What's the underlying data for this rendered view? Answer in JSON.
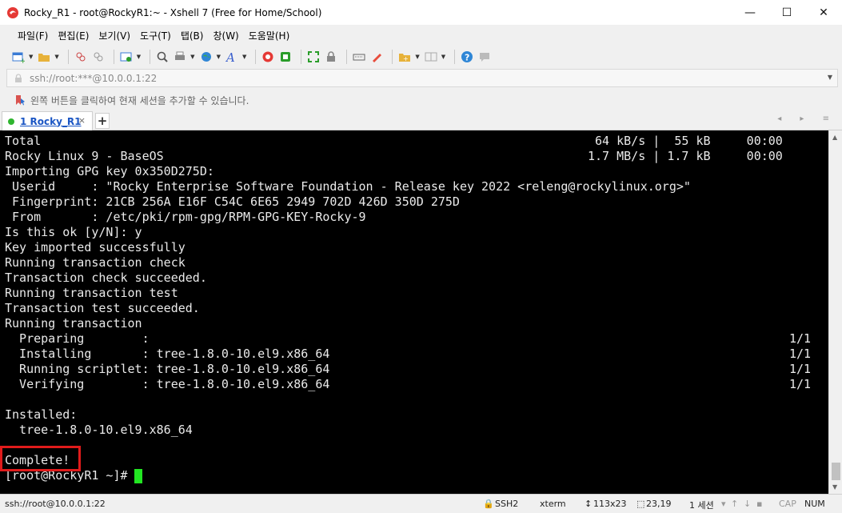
{
  "window": {
    "title": "Rocky_R1 - root@RockyR1:~ - Xshell 7 (Free for Home/School)",
    "minimize": "—",
    "maximize": "☐",
    "close": "✕"
  },
  "menu": [
    "파일(F)",
    "편집(E)",
    "보기(V)",
    "도구(T)",
    "탭(B)",
    "창(W)",
    "도움말(H)"
  ],
  "address": {
    "value": "ssh://root:***@10.0.0.1:22"
  },
  "hint": {
    "text": "왼쪽 버튼을 클릭하여 현재 세션을 추가할 수 있습니다."
  },
  "tabs": [
    {
      "label": "1 Rocky_R1",
      "close": "×"
    }
  ],
  "tab_add": "+",
  "tab_nav": "◂ ▸ ≡",
  "terminal": {
    "lines": [
      "Total",
      "Rocky Linux 9 - BaseOS",
      "Importing GPG key 0x350D275D:",
      " Userid     : \"Rocky Enterprise Software Foundation - Release key 2022 <releng@rockylinux.org>\"",
      " Fingerprint: 21CB 256A E16F C54C 6E65 2949 702D 426D 350D 275D",
      " From       : /etc/pki/rpm-gpg/RPM-GPG-KEY-Rocky-9",
      "Is this ok [y/N]: y",
      "Key imported successfully",
      "Running transaction check",
      "Transaction check succeeded.",
      "Running transaction test",
      "Transaction test succeeded.",
      "Running transaction",
      "  Preparing        :",
      "  Installing       : tree-1.8.0-10.el9.x86_64",
      "  Running scriptlet: tree-1.8.0-10.el9.x86_64",
      "  Verifying        : tree-1.8.0-10.el9.x86_64",
      "",
      "Installed:",
      "  tree-1.8.0-10.el9.x86_64",
      "",
      "Complete!",
      "[root@RockyR1 ~]# "
    ],
    "total_stats": " 64 kB/s |  55 kB     00:00",
    "baseos_stats": "1.7 MB/s | 1.7 kB     00:00",
    "progress": [
      "1/1",
      "1/1",
      "1/1",
      "1/1"
    ]
  },
  "status": {
    "connection": "ssh://root@10.0.0.1:22",
    "protocol": "SSH2",
    "term_type": "xterm",
    "size": "113x23",
    "cursor_pos": "23,19",
    "sessions": "1 세션",
    "caps": "CAP",
    "num": "NUM"
  },
  "colors": {
    "terminal_bg": "#000000",
    "terminal_fg": "#eaeaea",
    "cursor": "#22e622",
    "highlight": "#e01b1b",
    "tab_label": "#1b56c4"
  }
}
